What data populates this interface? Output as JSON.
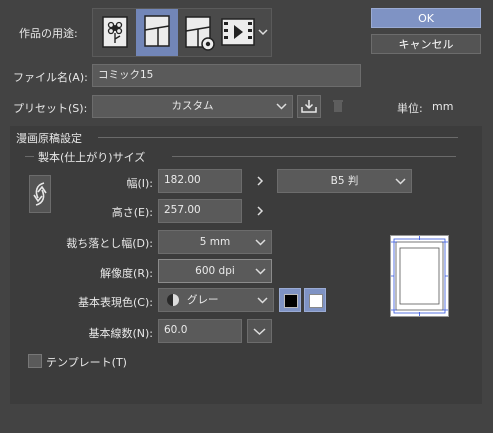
{
  "usage": {
    "label": "作品の用途:",
    "icons": [
      "illustration-icon",
      "comic-icon",
      "print-settings-icon",
      "animation-icon"
    ]
  },
  "buttons": {
    "ok": "OK",
    "cancel": "キャンセル"
  },
  "file_name": {
    "label": "ファイル名(A):",
    "value": "コミック15"
  },
  "preset": {
    "label": "プリセット(S):",
    "value": "カスタム",
    "unit_label": "単位:",
    "unit_value": "mm"
  },
  "manuscript": {
    "section_title": "漫画原稿設定",
    "subsection_title": "製本(仕上がり)サイズ",
    "width": {
      "label": "幅(I):",
      "value": "182.00"
    },
    "height": {
      "label": "高さ(E):",
      "value": "257.00"
    },
    "size_preset": {
      "value": "B5 判"
    },
    "bleed": {
      "label": "裁ち落とし幅(D):",
      "value": "5 mm"
    },
    "resolution": {
      "label": "解像度(R):",
      "value": "600 dpi"
    },
    "color": {
      "label": "基本表現色(C):",
      "value": "グレー"
    },
    "lines": {
      "label": "基本線数(N):",
      "value": "60.0"
    },
    "template": {
      "label": "テンプレート(T)",
      "checked": false
    }
  },
  "colors": {
    "accent": "#7f93c4",
    "selected_usage": "#7286b8"
  }
}
